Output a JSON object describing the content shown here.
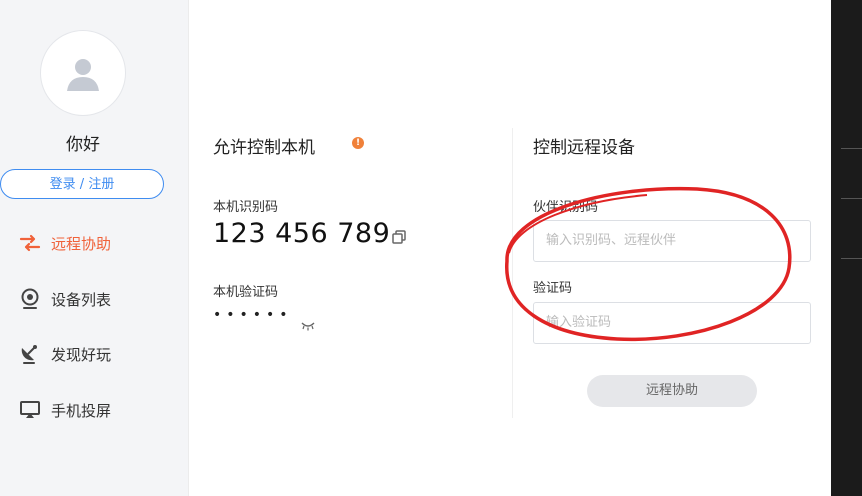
{
  "sidebar": {
    "greeting": "你好",
    "login_label": "登录 / 注册",
    "items": [
      {
        "label": "远程协助",
        "icon": "remote-assist-icon",
        "active": true
      },
      {
        "label": "设备列表",
        "icon": "device-list-icon",
        "active": false
      },
      {
        "label": "发现好玩",
        "icon": "satellite-dish-icon",
        "active": false
      },
      {
        "label": "手机投屏",
        "icon": "screen-cast-icon",
        "active": false
      }
    ]
  },
  "allow_control": {
    "title": "允许控制本机",
    "id_label": "本机识别码",
    "id_value": "123 456 789",
    "code_label": "本机验证码",
    "code_value": "••••••"
  },
  "remote_control": {
    "title": "控制远程设备",
    "partner_id_label": "伙伴识别码",
    "partner_id_placeholder": "输入识别码、远程伙伴",
    "code_label": "验证码",
    "code_placeholder": "输入验证码",
    "connect_label": "远程协助"
  },
  "colors": {
    "accent": "#f0623a",
    "primary": "#3f8cf0",
    "annotation": "#e02424"
  }
}
